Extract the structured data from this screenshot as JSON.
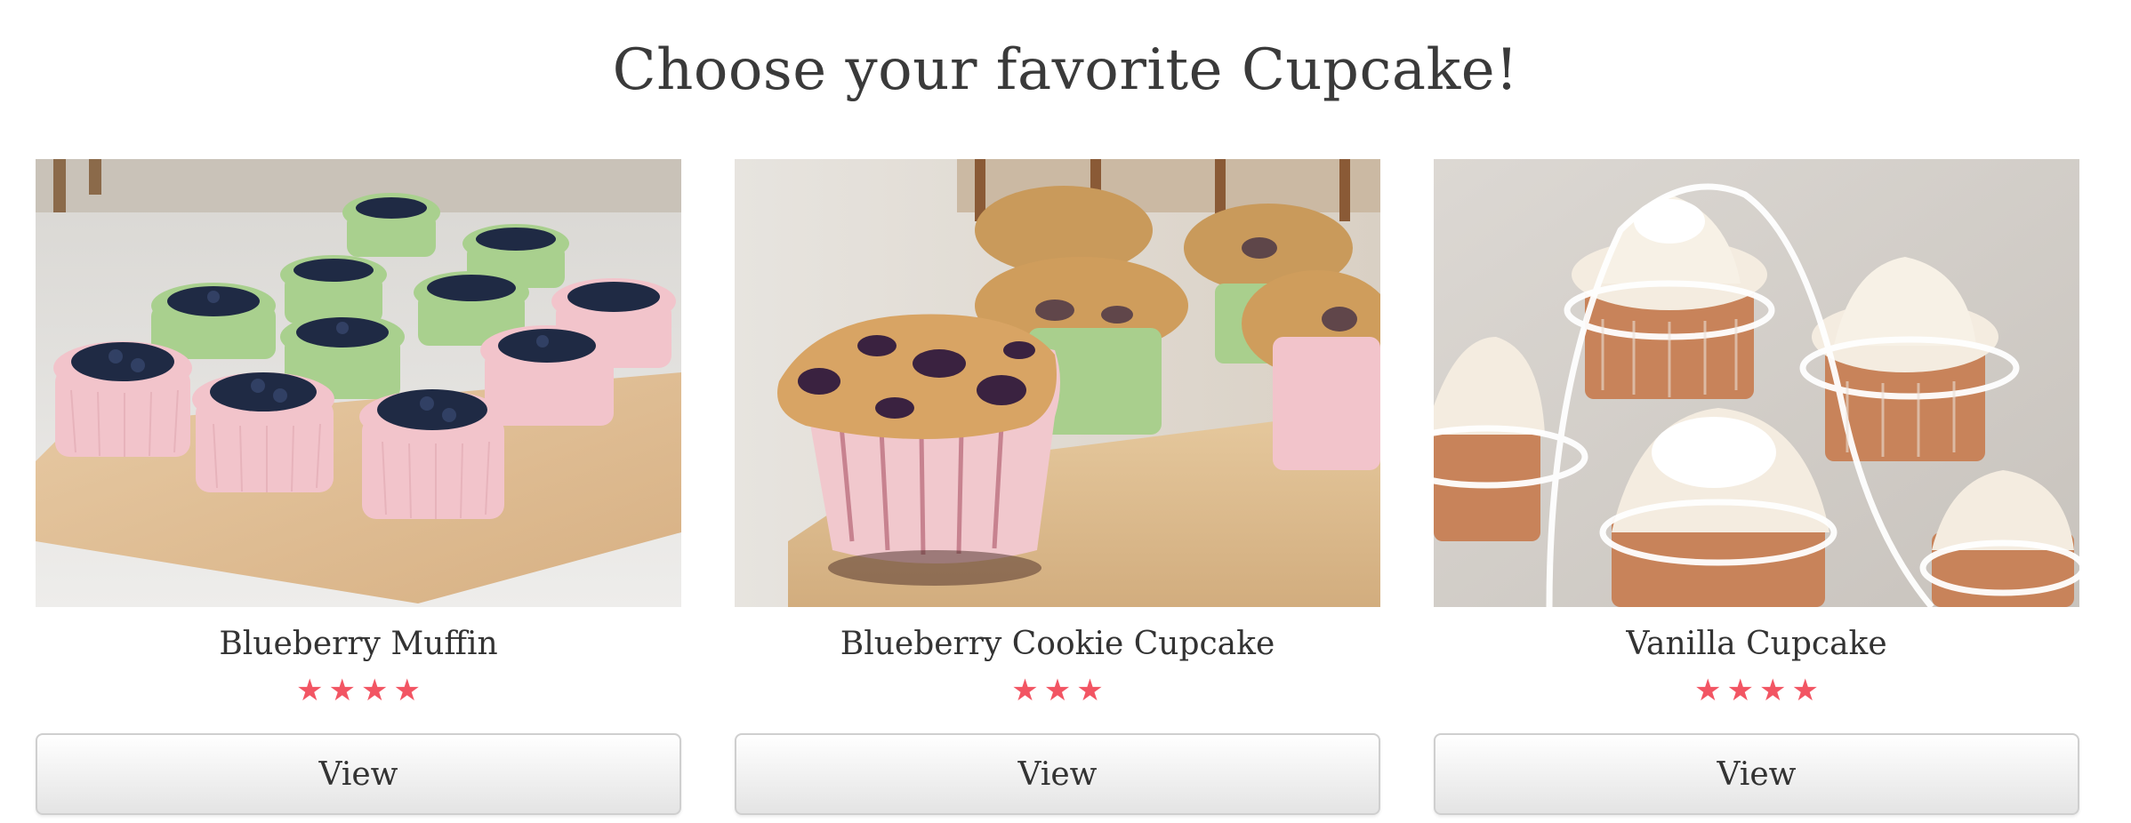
{
  "heading": "Choose your favorite Cupcake!",
  "accent_color": "#f25563",
  "products": [
    {
      "name": "Blueberry Muffin",
      "rating": 4,
      "stars": [
        "★",
        "★",
        "★",
        "★"
      ],
      "button_label": "View",
      "image_alt": "Blueberry Muffin"
    },
    {
      "name": "Blueberry Cookie Cupcake",
      "rating": 3,
      "stars": [
        "★",
        "★",
        "★"
      ],
      "button_label": "View",
      "image_alt": "Blueberry Cookie Cupcake"
    },
    {
      "name": "Vanilla Cupcake",
      "rating": 4,
      "stars": [
        "★",
        "★",
        "★",
        "★"
      ],
      "button_label": "View",
      "image_alt": "Vanilla Cupcake"
    }
  ]
}
